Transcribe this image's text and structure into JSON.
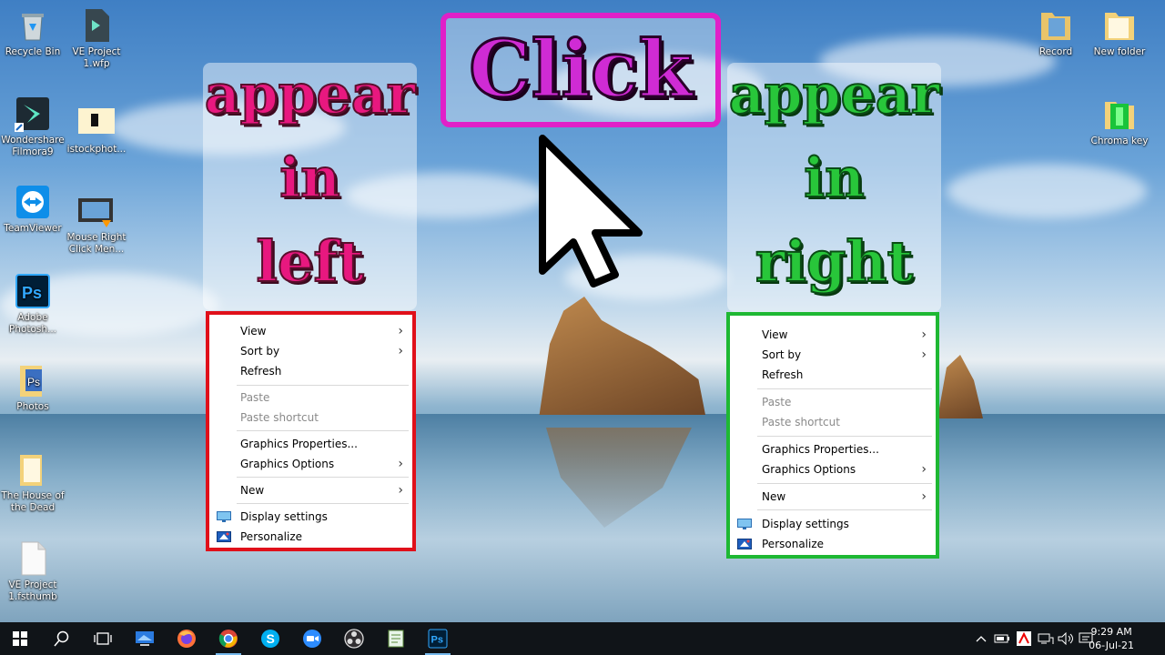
{
  "desktop": {
    "icons": [
      {
        "label": "Recycle Bin",
        "icon": "recycle-bin-icon"
      },
      {
        "label": "VE Project 1.wfp",
        "icon": "file-icon"
      },
      {
        "label": "Wondershare Filmora9",
        "icon": "filmora-icon"
      },
      {
        "label": "istockphot...",
        "icon": "image-file-icon"
      },
      {
        "label": "TeamViewer",
        "icon": "teamviewer-icon"
      },
      {
        "label": "Mouse Right Click Men...",
        "icon": "video-file-icon"
      },
      {
        "label": "Adobe Photosh...",
        "icon": "photoshop-icon"
      },
      {
        "label": "Photos",
        "icon": "folder-icon"
      },
      {
        "label": "The House of the Dead",
        "icon": "folder-icon"
      },
      {
        "label": "VE Project 1.fsthumb",
        "icon": "file-icon"
      },
      {
        "label": "Record",
        "icon": "folder-icon"
      },
      {
        "label": "New folder",
        "icon": "folder-icon"
      },
      {
        "label": "Chroma key",
        "icon": "folder-icon"
      }
    ]
  },
  "overlay": {
    "left_lines": [
      "appear",
      "in",
      "left"
    ],
    "right_lines": [
      "appear",
      "in",
      "right"
    ],
    "click": "Click",
    "colors": {
      "left": "#e8187f",
      "right": "#28c63a",
      "click_border": "#e020c8",
      "left_border": "#e0101a",
      "right_border": "#1eb833"
    }
  },
  "context_menu": {
    "items": {
      "view": "View",
      "sort_by": "Sort by",
      "refresh": "Refresh",
      "paste": "Paste",
      "paste_shortcut": "Paste shortcut",
      "graphics_properties": "Graphics Properties...",
      "graphics_options": "Graphics Options",
      "new": "New",
      "display_settings": "Display settings",
      "personalize": "Personalize"
    },
    "submenu_arrow": "›"
  },
  "taskbar": {
    "icons": [
      "windows-start-icon",
      "search-icon",
      "task-view-icon",
      "desktop-app-icon",
      "firefox-icon",
      "chrome-icon",
      "skype-icon",
      "zoom-icon",
      "obs-icon",
      "notepad-icon",
      "photoshop-icon"
    ],
    "clock": {
      "time": "9:29 AM",
      "date": "06-Jul-21"
    }
  }
}
